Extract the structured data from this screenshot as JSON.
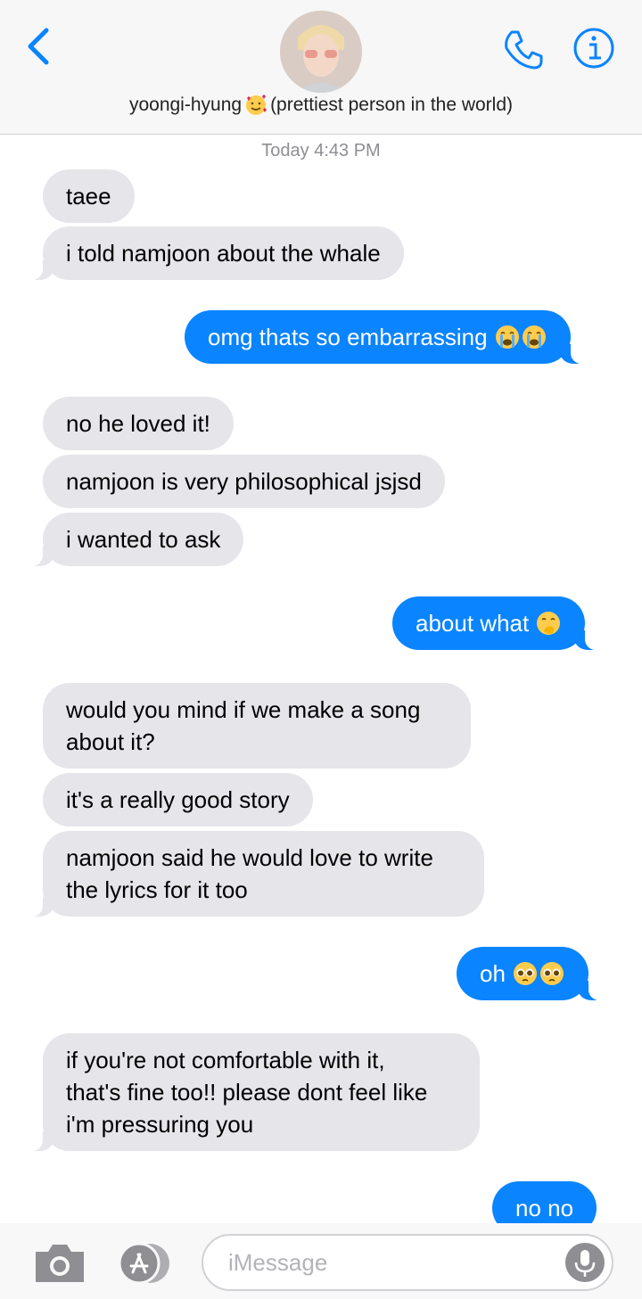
{
  "header": {
    "back_label": "Back",
    "contact_name": "yoongi-hyung",
    "contact_note": "(prettiest person in the world)",
    "name_emoji": "smiling-face-with-hearts-icon"
  },
  "timestamp": "Today 4:43 PM",
  "messages": [
    {
      "from": "them",
      "text": "taee"
    },
    {
      "from": "them",
      "text": "i told namjoon about the whale"
    },
    {
      "from": "me",
      "text": "omg thats so embarrassing",
      "emoji": [
        "loudly-crying-face-icon",
        "loudly-crying-face-icon"
      ]
    },
    {
      "from": "them",
      "text": "no he loved it!"
    },
    {
      "from": "them",
      "text": "namjoon is very philosophical jsjsd"
    },
    {
      "from": "them",
      "text": "i wanted to ask"
    },
    {
      "from": "me",
      "text": "about what",
      "emoji": [
        "face-with-hand-over-mouth-icon"
      ]
    },
    {
      "from": "them",
      "lines": [
        "would you mind if we make a song",
        "about it?"
      ]
    },
    {
      "from": "them",
      "text": "it's a really good story"
    },
    {
      "from": "them",
      "lines": [
        "namjoon said he would love to write",
        "the lyrics for it too"
      ]
    },
    {
      "from": "me",
      "text": "oh",
      "emoji": [
        "pleading-face-icon",
        "pleading-face-icon"
      ]
    },
    {
      "from": "them",
      "lines": [
        "if you're not comfortable with it,",
        "that's fine too!! please dont feel like",
        "i'm pressuring you"
      ]
    },
    {
      "from": "me",
      "text": "no no"
    }
  ],
  "composer": {
    "placeholder": "iMessage"
  },
  "colors": {
    "accent": "#0a84ff",
    "incoming_bubble": "#e5e5ea",
    "timestamp": "#8e8e93"
  }
}
